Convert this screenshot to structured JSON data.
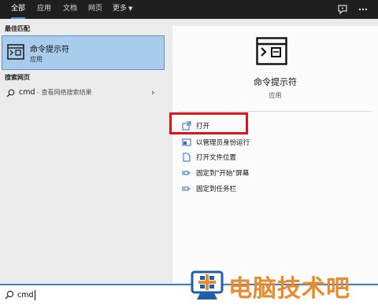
{
  "tabs": [
    {
      "label": "全部",
      "active": true
    },
    {
      "label": "应用"
    },
    {
      "label": "文档"
    },
    {
      "label": "网页"
    },
    {
      "label": "更多"
    }
  ],
  "left": {
    "best_match_heading": "最佳匹配",
    "best_match": {
      "title": "命令提示符",
      "subtitle": "应用",
      "icon": "cmd-window-icon"
    },
    "web_heading": "搜索网页",
    "web_result": {
      "query": "cmd",
      "hint": " - 查看网络搜索结果"
    }
  },
  "preview": {
    "title": "命令提示符",
    "subtitle": "应用",
    "actions": [
      {
        "label": "打开",
        "icon": "open-icon"
      },
      {
        "label": "以管理员身份运行",
        "icon": "shield-icon"
      },
      {
        "label": "打开文件位置",
        "icon": "file-icon"
      },
      {
        "label": "固定到\"开始\"屏幕",
        "icon": "pin-icon"
      },
      {
        "label": "固定到任务栏",
        "icon": "pin-icon"
      }
    ]
  },
  "search": {
    "value": "cmd"
  },
  "watermark": {
    "text": "电脑技术吧"
  },
  "colors": {
    "highlight": "#a9cbec",
    "accent": "#4a8fd8",
    "annotation": "#e1141b",
    "watermark": "#e88b2c"
  }
}
